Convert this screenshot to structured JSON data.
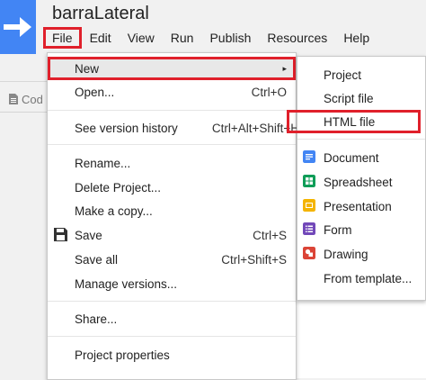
{
  "header": {
    "project_title": "barraLateral",
    "menu": [
      "File",
      "Edit",
      "View",
      "Run",
      "Publish",
      "Resources",
      "Help"
    ]
  },
  "sidebar": {
    "code_tab_label": "Cod"
  },
  "file_menu": {
    "new": {
      "label": "New",
      "arrow": "▸"
    },
    "open": {
      "label": "Open...",
      "shortcut": "Ctrl+O"
    },
    "version_history": {
      "label": "See version history",
      "shortcut": "Ctrl+Alt+Shift+H"
    },
    "rename": {
      "label": "Rename..."
    },
    "delete": {
      "label": "Delete Project..."
    },
    "copy": {
      "label": "Make a copy..."
    },
    "save": {
      "label": "Save",
      "shortcut": "Ctrl+S"
    },
    "save_all": {
      "label": "Save all",
      "shortcut": "Ctrl+Shift+S"
    },
    "manage_versions": {
      "label": "Manage versions..."
    },
    "share": {
      "label": "Share..."
    },
    "properties": {
      "label": "Project properties"
    }
  },
  "new_submenu": {
    "project": "Project",
    "script_file": "Script file",
    "html_file": "HTML file",
    "document": "Document",
    "spreadsheet": "Spreadsheet",
    "presentation": "Presentation",
    "form": "Form",
    "drawing": "Drawing",
    "from_template": "From template..."
  },
  "colors": {
    "brand_blue": "#4285f4",
    "highlight_red": "#e0202b",
    "document": "#4285f4",
    "spreadsheet": "#0f9d58",
    "presentation": "#f4b400",
    "form": "#7248b9",
    "drawing": "#db4437"
  }
}
